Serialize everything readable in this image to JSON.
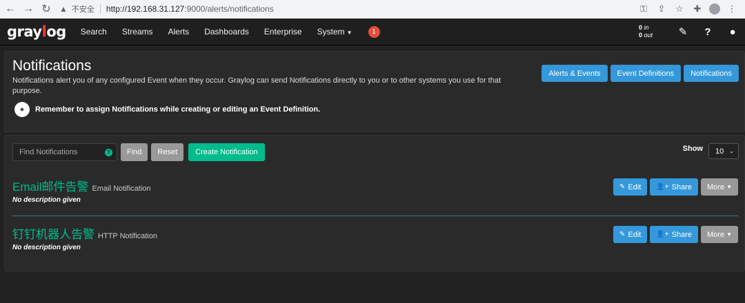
{
  "browser": {
    "insecure_label": "不安全",
    "url_host": "http://192.168.31.127",
    "url_path": ":9000/alerts/notifications"
  },
  "navbar": {
    "logo_pre": "gray",
    "logo_o": "l",
    "logo_post": "og",
    "items": [
      "Search",
      "Streams",
      "Alerts",
      "Dashboards",
      "Enterprise",
      "System"
    ],
    "alert_count": "1",
    "throughput_in": "0",
    "throughput_in_label": "in",
    "throughput_out": "0",
    "throughput_out_label": "out"
  },
  "header": {
    "title": "Notifications",
    "description": "Notifications alert you of any configured Event when they occur. Graylog can send Notifications directly to you or to other systems you use for that purpose.",
    "tip": "Remember to assign Notifications while creating or editing an Event Definition.",
    "buttons": [
      "Alerts & Events",
      "Event Definitions",
      "Notifications"
    ]
  },
  "toolbar": {
    "search_placeholder": "Find Notifications",
    "find_label": "Find",
    "reset_label": "Reset",
    "create_label": "Create Notification",
    "show_label": "Show",
    "show_value": "10"
  },
  "notifications": [
    {
      "title": "Email邮件告警",
      "type": "Email Notification",
      "description": "No description given",
      "edit_label": "Edit",
      "share_label": "Share",
      "more_label": "More"
    },
    {
      "title": "钉钉机器人告警",
      "type": "HTTP Notification",
      "description": "No description given",
      "edit_label": "Edit",
      "share_label": "Share",
      "more_label": "More"
    }
  ]
}
